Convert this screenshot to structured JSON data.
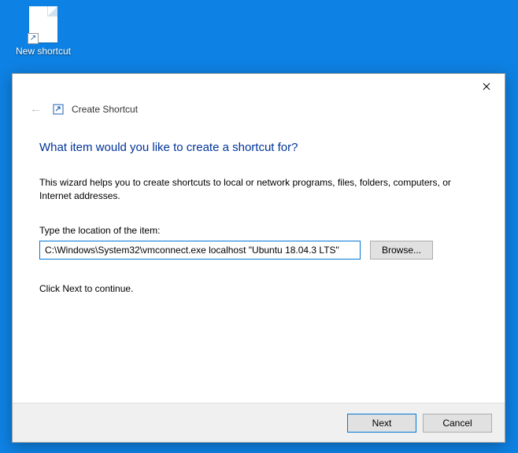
{
  "desktop": {
    "icon_label": "New shortcut"
  },
  "dialog": {
    "header_title": "Create Shortcut",
    "main_heading": "What item would you like to create a shortcut for?",
    "description": "This wizard helps you to create shortcuts to local or network programs, files, folders, computers, or Internet addresses.",
    "location_label": "Type the location of the item:",
    "location_value": "C:\\Windows\\System32\\vmconnect.exe localhost \"Ubuntu 18.04.3 LTS\"",
    "browse_label": "Browse...",
    "continue_hint": "Click Next to continue.",
    "next_label": "Next",
    "cancel_label": "Cancel"
  }
}
